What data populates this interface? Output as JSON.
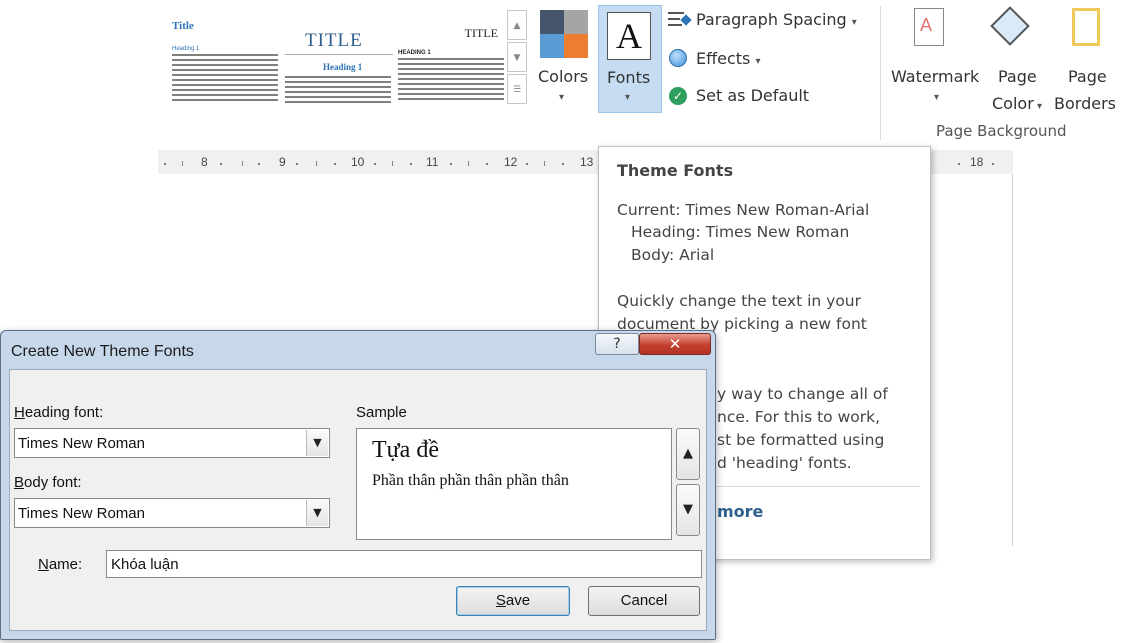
{
  "ribbon": {
    "themes": [
      {
        "title": "Title",
        "heading": "Heading 1"
      },
      {
        "title": "TITLE",
        "heading": "Heading 1"
      },
      {
        "title": "TITLE",
        "heading": "HEADING 1"
      }
    ],
    "colors_label": "Colors",
    "fonts_label": "Fonts",
    "fonts_glyph": "A",
    "paragraph_spacing_label": "Paragraph Spacing",
    "effects_label": "Effects",
    "set_as_default_label": "Set as Default",
    "watermark_label": "Watermark",
    "page_color_label_1": "Page",
    "page_color_label_2": "Color",
    "page_borders_label_1": "Page",
    "page_borders_label_2": "Borders",
    "page_background_group": "Page Background",
    "colors": {
      "accent_orange": "#ed7d31",
      "accent_dark": "#44546a",
      "accent_blue": "#5b9bd5",
      "accent_gray": "#a5a5a5"
    }
  },
  "ruler": {
    "numbers": [
      "8",
      "9",
      "10",
      "11",
      "12",
      "13",
      "18"
    ]
  },
  "tooltip": {
    "title": "Theme Fonts",
    "current": "Current: Times New Roman-Arial",
    "heading": "Heading: Times New Roman",
    "body": "Body: Arial",
    "desc_1": "Quickly change the text in your",
    "desc_2": "document by picking a new font",
    "frag_1": "y way to change all of",
    "frag_2": "nce. For this to work,",
    "frag_3": "st be formatted using",
    "frag_4": "d 'heading' fonts.",
    "more": "more"
  },
  "dialog": {
    "title": "Create New Theme Fonts",
    "help": "?",
    "close": "✕",
    "heading_font_label_first": "H",
    "heading_font_label_rest": "eading font:",
    "heading_font_value": "Times New Roman",
    "body_font_label_first": "B",
    "body_font_label_rest": "ody font:",
    "body_font_value": "Times New Roman",
    "sample_label": "Sample",
    "sample_heading": "Tựa đề",
    "sample_body": "Phần thân phần thân phần thân",
    "name_label_first": "N",
    "name_label_rest": "ame:",
    "name_value": "Khóa luận",
    "save_first": "S",
    "save_rest": "ave",
    "cancel": "Cancel"
  }
}
